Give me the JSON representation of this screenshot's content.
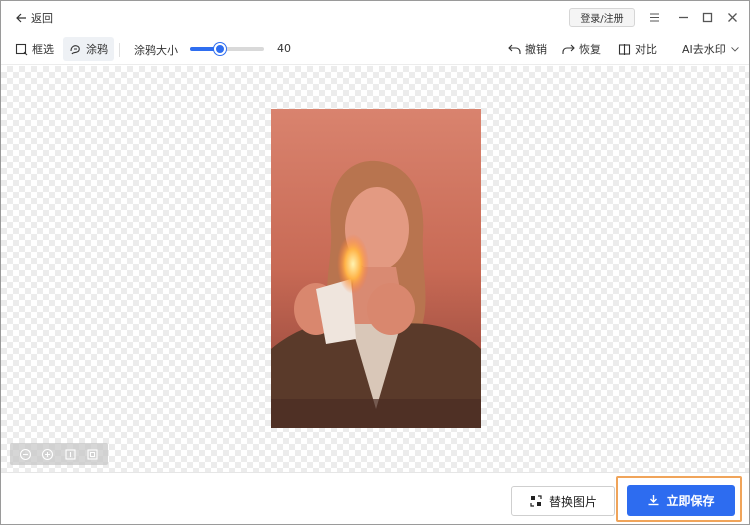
{
  "titlebar": {
    "back_label": "返回",
    "login_label": "登录/注册"
  },
  "toolbar": {
    "box_select_label": "框选",
    "brush_label": "涂鸦",
    "brush_size_label": "涂鸦大小",
    "brush_size_value": "40",
    "brush_size_fraction": 0.4,
    "undo_label": "撤销",
    "redo_label": "恢复",
    "compare_label": "对比",
    "ai_label": "AI去水印"
  },
  "footer": {
    "replace_label": "替换图片",
    "save_label": "立即保存"
  },
  "colors": {
    "accent": "#2d6cf0",
    "highlight_outline": "#f0a45a"
  }
}
